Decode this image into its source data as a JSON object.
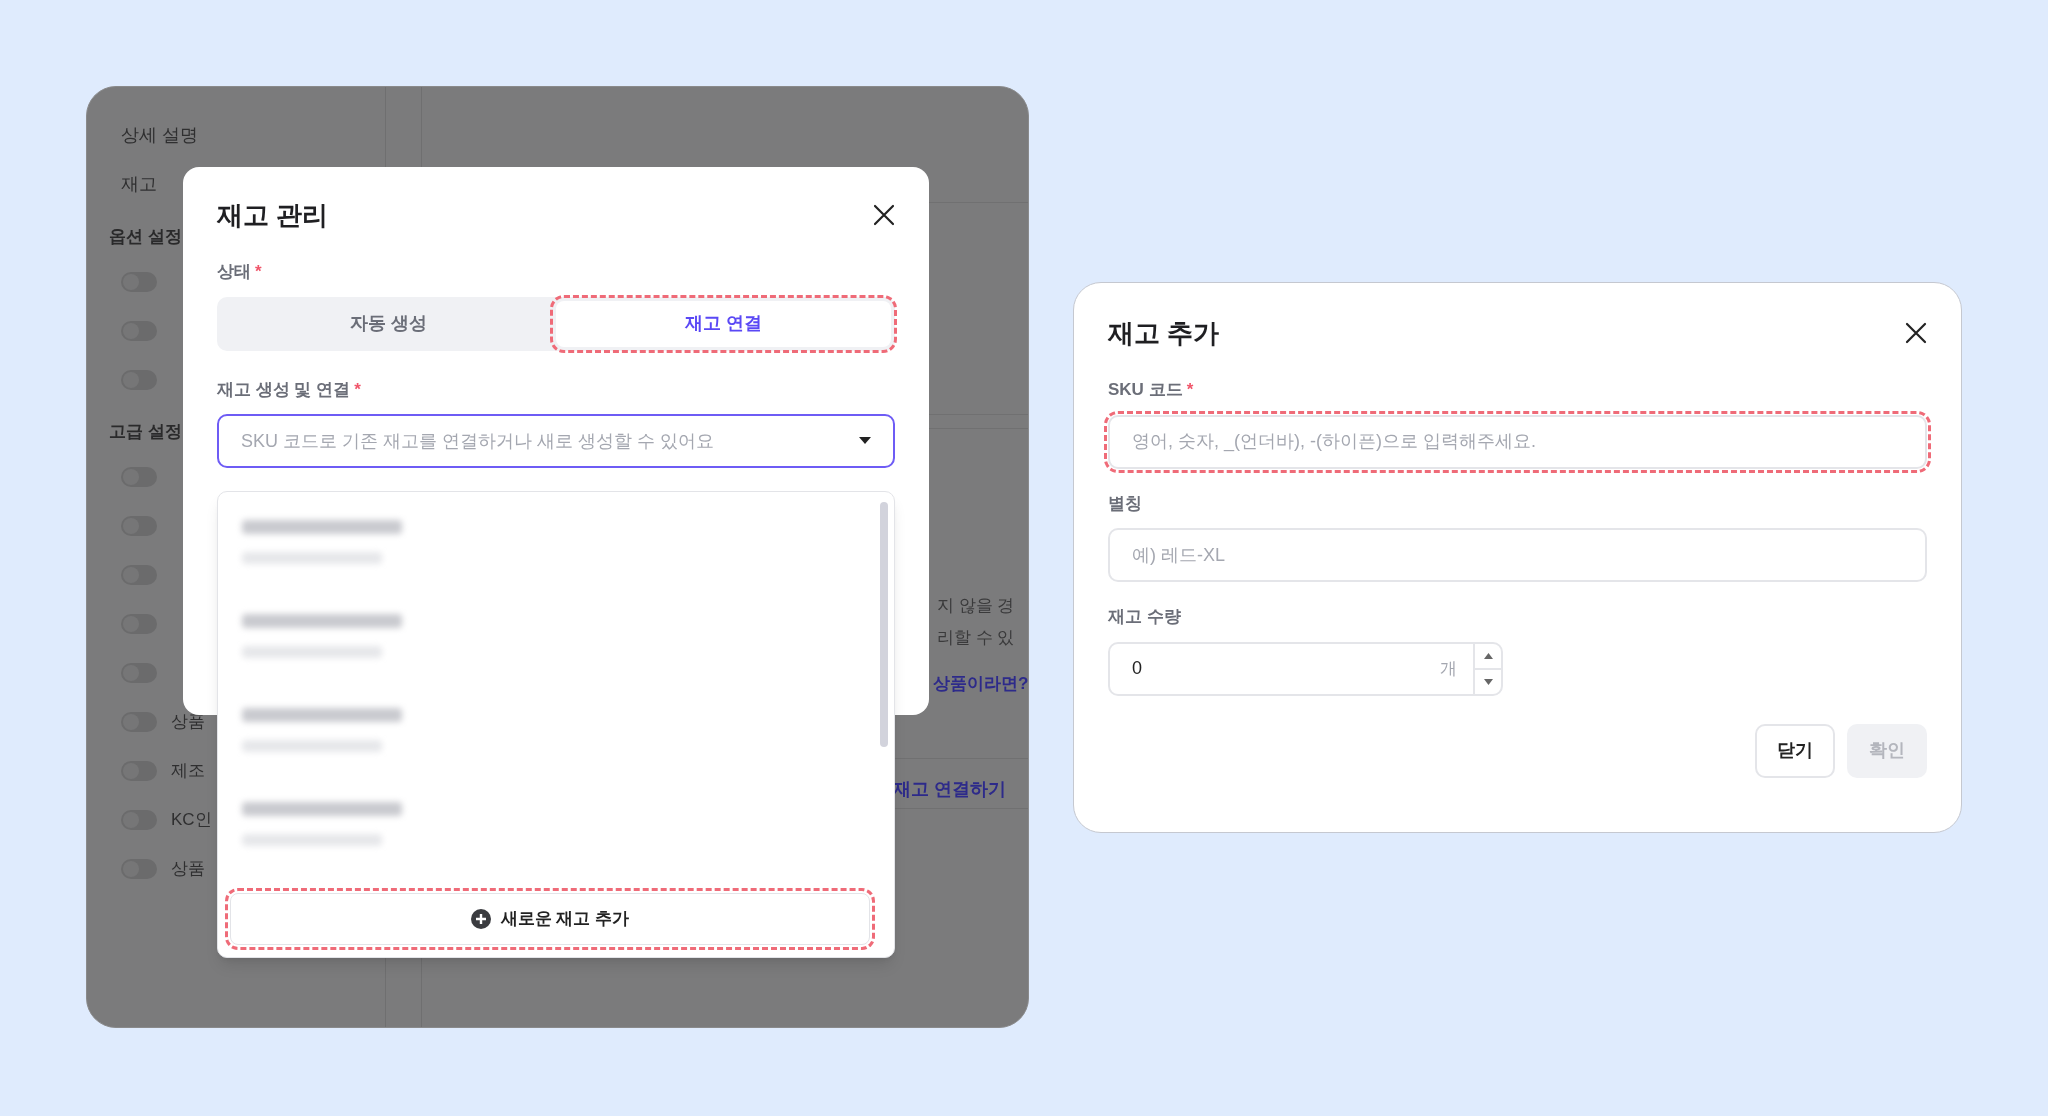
{
  "background_page": {
    "sidebar": {
      "items": [
        {
          "label": "상세 설명"
        },
        {
          "label": "재고"
        }
      ],
      "sections": [
        {
          "title": "옵션 설정",
          "toggles": [
            {
              "on": false
            },
            {
              "on": false
            },
            {
              "on": false
            }
          ]
        },
        {
          "title": "고급 설정",
          "toggles": [
            {
              "on": false
            },
            {
              "on": false
            },
            {
              "on": false
            },
            {
              "on": false
            },
            {
              "on": false
            },
            {
              "label": "상품",
              "on": false
            },
            {
              "label": "제조",
              "on": false
            },
            {
              "label": "KC인",
              "on": false
            },
            {
              "label": "상품",
              "on": false
            }
          ]
        }
      ]
    },
    "notice_lines": [
      "지 않을 경",
      "리할 수 있"
    ],
    "link": "상품이라면?",
    "link_button": "재고 연결하기"
  },
  "inventory_modal": {
    "title": "재고 관리",
    "status_label": {
      "text": "상태",
      "mark": "*"
    },
    "tabs": [
      {
        "label": "자동 생성",
        "selected": false,
        "highlighted": false
      },
      {
        "label": "재고 연결",
        "selected": true,
        "highlighted": true
      }
    ],
    "link_label": {
      "text": "재고 생성 및 연결",
      "mark": "*"
    },
    "select": {
      "placeholder": "SKU 코드로 기존 재고를 연결하거나 새로 생성할 수 있어요"
    },
    "dropdown": {
      "items": [
        {
          "kind": "blurred"
        },
        {
          "kind": "blurred"
        },
        {
          "kind": "blurred"
        },
        {
          "kind": "blurred"
        }
      ],
      "add_button": {
        "label": "새로운 재고 추가",
        "highlighted": true
      }
    }
  },
  "add_modal": {
    "title": "재고 추가",
    "sku": {
      "label": "SKU 코드",
      "mark": "*",
      "placeholder": "영어, 숫자, _(언더바), -(하이픈)으로 입력해주세요.",
      "highlighted": true
    },
    "alias": {
      "label": "별칭",
      "placeholder": "예) 레드-XL",
      "highlighted": false
    },
    "quantity": {
      "label": "재고 수량",
      "value": "0",
      "unit": "개"
    },
    "buttons": [
      {
        "label": "닫기",
        "disabled": false
      },
      {
        "label": "확인",
        "disabled": true
      }
    ]
  }
}
